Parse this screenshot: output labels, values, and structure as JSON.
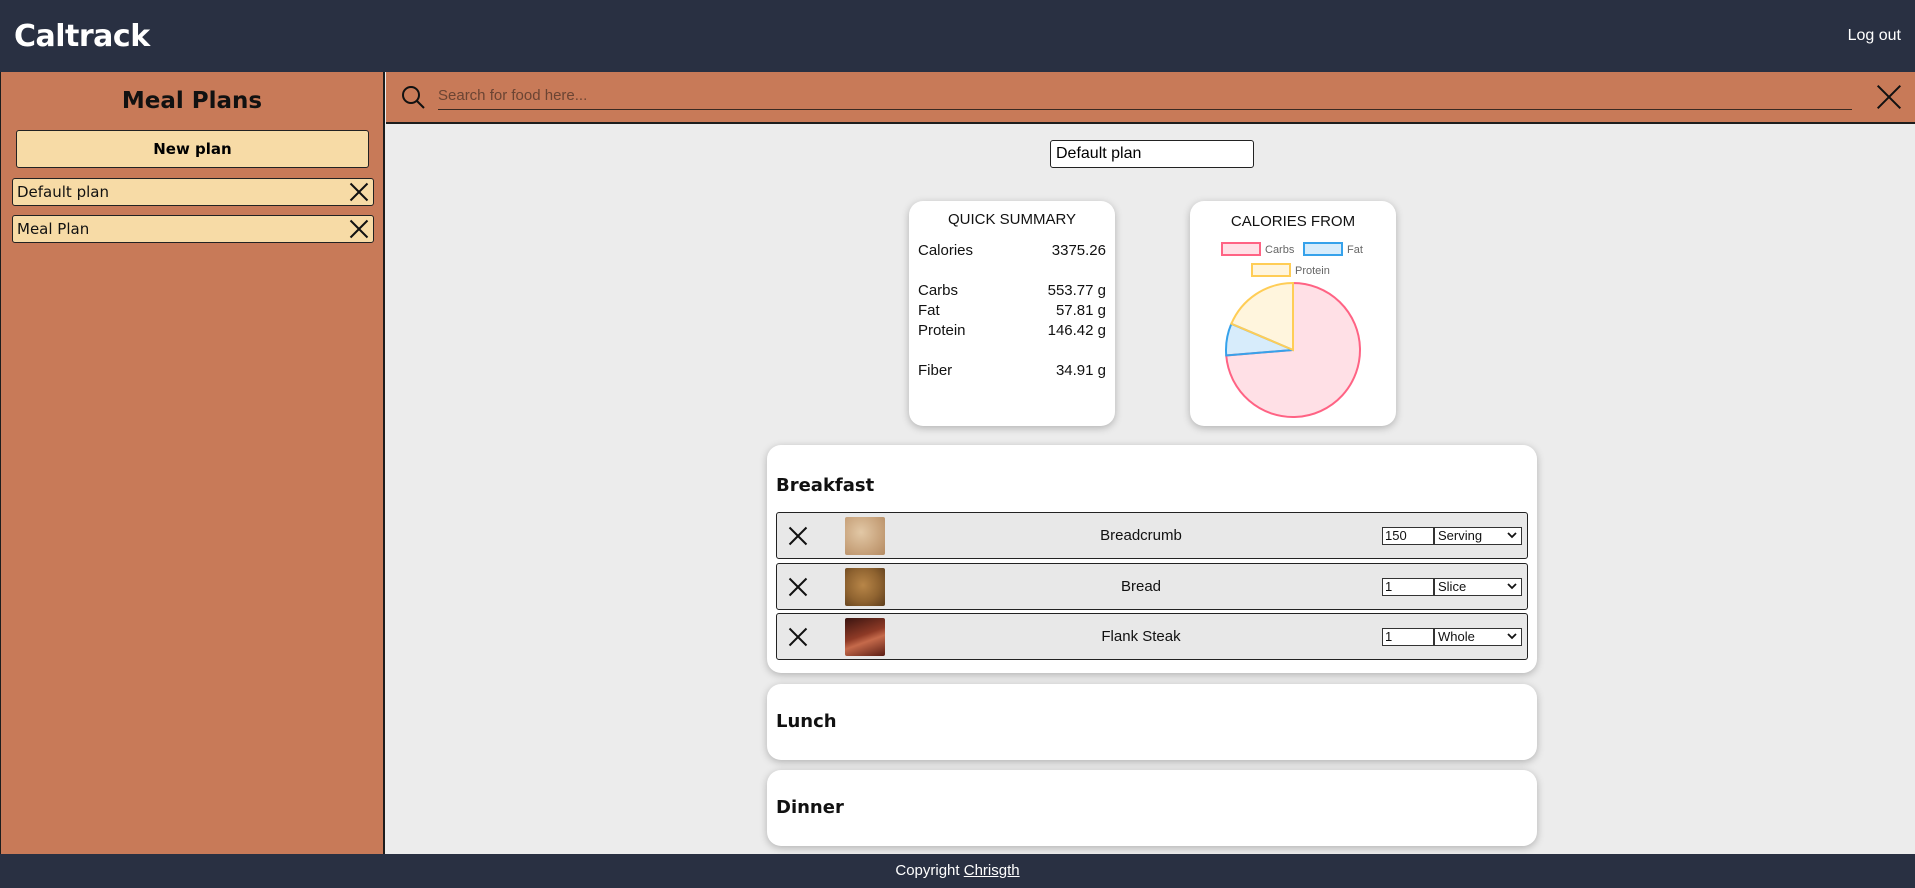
{
  "header": {
    "brand": "Caltrack",
    "logout": "Log out"
  },
  "sidebar": {
    "title": "Meal Plans",
    "new_plan": "New plan",
    "plans": [
      {
        "name": "Default plan"
      },
      {
        "name": "Meal Plan"
      }
    ]
  },
  "search": {
    "placeholder": "Search for food here..."
  },
  "plan": {
    "name": "Default plan"
  },
  "summary": {
    "title": "QUICK SUMMARY",
    "calories_label": "Calories",
    "calories": "3375.26",
    "carbs_label": "Carbs",
    "carbs": "553.77 g",
    "fat_label": "Fat",
    "fat": "57.81 g",
    "protein_label": "Protein",
    "protein": "146.42 g",
    "fiber_label": "Fiber",
    "fiber": "34.91 g"
  },
  "chart": {
    "title": "CALORIES FROM",
    "legend": [
      "Carbs",
      "Fat",
      "Protein"
    ]
  },
  "chart_data": {
    "type": "pie",
    "title": "CALORIES FROM",
    "labels": [
      "Carbs",
      "Fat",
      "Protein"
    ],
    "values": [
      73.7,
      7.7,
      18.6
    ],
    "colors": [
      "#ff6384",
      "#36a2eb",
      "#ffcd56"
    ],
    "legend_position": "top"
  },
  "meals": {
    "breakfast": {
      "title": "Breakfast",
      "items": [
        {
          "name": "Breadcrumb",
          "qty": "150",
          "unit": "Serving"
        },
        {
          "name": "Bread",
          "qty": "1",
          "unit": "Slice"
        },
        {
          "name": "Flank Steak",
          "qty": "1",
          "unit": "Whole"
        }
      ]
    },
    "lunch": {
      "title": "Lunch"
    },
    "dinner": {
      "title": "Dinner"
    }
  },
  "footer": {
    "prefix": "Copyright",
    "author": "Chrisgth"
  }
}
